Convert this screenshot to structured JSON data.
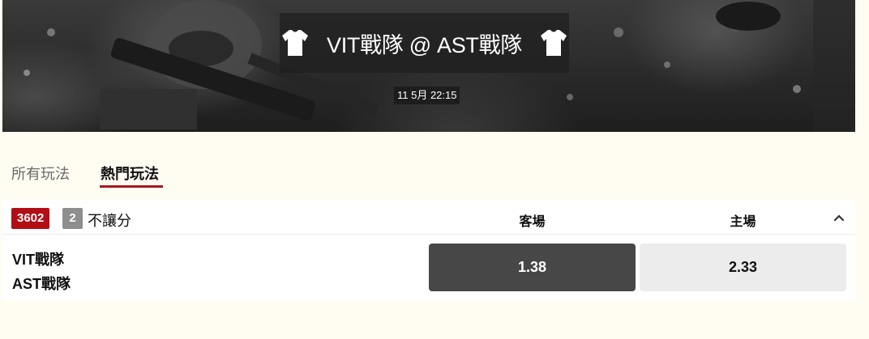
{
  "event": {
    "title": "VIT戰隊 @ AST戰隊",
    "datetime": "11 5月 22:15",
    "away_icon": "shirt-icon",
    "home_icon": "shirt-icon"
  },
  "tabs": [
    {
      "label": "所有玩法",
      "active": false
    },
    {
      "label": "熱門玩法",
      "active": true
    }
  ],
  "market": {
    "code": "3602",
    "count": "2",
    "name": "不讓分",
    "columns": {
      "away": "客場",
      "home": "主場"
    },
    "collapse_icon": "chevron-up-icon",
    "teams": [
      "VIT戰隊",
      "AST戰隊"
    ],
    "odds": {
      "away": "1.38",
      "home": "2.33"
    }
  },
  "colors": {
    "accent": "#a8161c",
    "code_badge": "#b20e16",
    "selected_odd": "#474747",
    "odd": "#ececec",
    "page_bg": "#fffcf2"
  }
}
